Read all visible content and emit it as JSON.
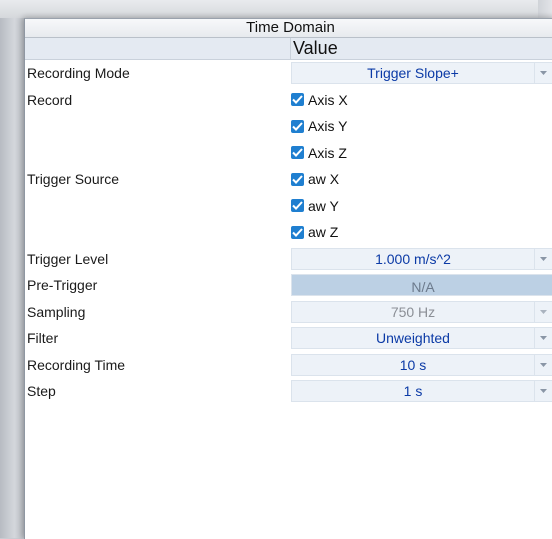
{
  "panel": {
    "title": "Time Domain",
    "value_header": "Value"
  },
  "rows": [
    {
      "label": "Recording Mode",
      "type": "dropdown",
      "value": "Trigger Slope+"
    },
    {
      "label": "Record",
      "type": "checkbox",
      "value": "Axis X",
      "checked": true
    },
    {
      "label": "",
      "type": "checkbox",
      "value": "Axis Y",
      "checked": true
    },
    {
      "label": "",
      "type": "checkbox",
      "value": "Axis Z",
      "checked": true
    },
    {
      "label": "Trigger Source",
      "type": "checkbox",
      "value": "aw X",
      "checked": true
    },
    {
      "label": "",
      "type": "checkbox",
      "value": "aw Y",
      "checked": true
    },
    {
      "label": "",
      "type": "checkbox",
      "value": "aw Z",
      "checked": true
    },
    {
      "label": "Trigger Level",
      "type": "dropdown",
      "value": "1.000 m/s^2"
    },
    {
      "label": "Pre-Trigger",
      "type": "readonly",
      "value": "N/A"
    },
    {
      "label": "Sampling",
      "type": "dropdown-disabled",
      "value": "750 Hz"
    },
    {
      "label": "Filter",
      "type": "dropdown",
      "value": "Unweighted"
    },
    {
      "label": "Recording Time",
      "type": "dropdown",
      "value": "10 s"
    },
    {
      "label": "Step",
      "type": "dropdown",
      "value": "1 s"
    }
  ],
  "icons": {
    "dropdown_arrow": "chevron-down-icon",
    "checkbox": "checkmark-icon"
  },
  "colors": {
    "accent_text": "#0b3aa6",
    "checkbox_fill": "#1f7fd0",
    "readonly_fill": "#bcd0e4",
    "dropdown_fill": "#edf2f8"
  }
}
